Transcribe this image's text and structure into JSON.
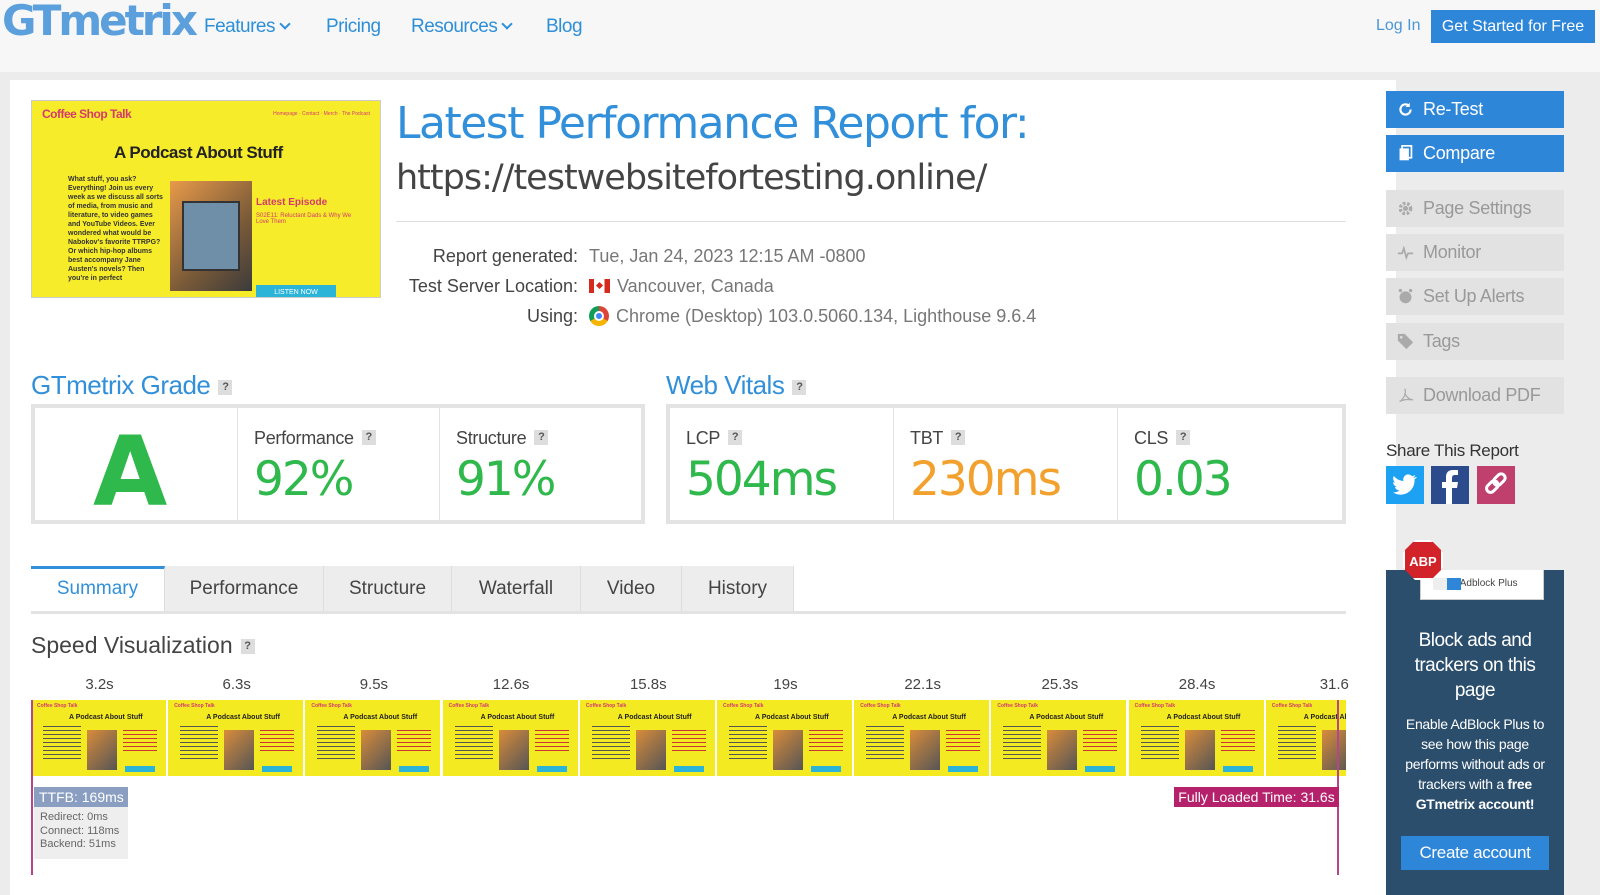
{
  "nav": {
    "logo": "GTmetrix",
    "items": [
      "Features",
      "Pricing",
      "Resources",
      "Blog"
    ],
    "login": "Log In",
    "get_started": "Get Started for Free"
  },
  "report": {
    "title": "Latest Performance Report for:",
    "url": "https://testwebsitefortesting.online/",
    "generated_label": "Report generated:",
    "generated_value": "Tue, Jan 24, 2023 12:15 AM -0800",
    "location_label": "Test Server Location:",
    "location_value": "Vancouver, Canada",
    "using_label": "Using:",
    "using_value": "Chrome (Desktop) 103.0.5060.134, Lighthouse 9.6.4"
  },
  "thumbnail": {
    "site_name": "Coffee Shop Talk",
    "nav": "Homepage · Contact · Merch · The Podcast",
    "headline": "A Podcast About Stuff",
    "intro": "What stuff, you ask? Everything! Join us every week as we discuss all sorts of media, from music and literature, to video games and YouTube Videos. Ever wondered what would be Nabokov's favorite TTRPG? Or which hip-hop albums best accompany Jane Austen's novels? Then you're in perfect",
    "latest": "Latest Episode",
    "episode": "S02E11: Reluctant Dads & Why We Love Them",
    "cta": "LISTEN NOW"
  },
  "grade": {
    "heading": "GTmetrix Grade",
    "letter": "A",
    "performance_label": "Performance",
    "performance_value": "92%",
    "structure_label": "Structure",
    "structure_value": "91%"
  },
  "vitals": {
    "heading": "Web Vitals",
    "lcp_label": "LCP",
    "lcp_value": "504ms",
    "tbt_label": "TBT",
    "tbt_value": "230ms",
    "cls_label": "CLS",
    "cls_value": "0.03"
  },
  "colors": {
    "brand_blue": "#3190d9",
    "good_green": "#2fb84b",
    "warn_orange": "#f2a12e",
    "frame_yellow": "#f4ea22",
    "marker_pink": "#b5226b"
  },
  "tabs": [
    "Summary",
    "Performance",
    "Structure",
    "Waterfall",
    "Video",
    "History"
  ],
  "speed": {
    "heading": "Speed Visualization",
    "frame_times": [
      "3.2s",
      "6.3s",
      "9.5s",
      "12.6s",
      "15.8s",
      "19s",
      "22.1s",
      "25.3s",
      "28.4s",
      "31.6"
    ],
    "frame_label": "A Podcast About Stuff",
    "ttfb": "TTFB: 169ms",
    "redirect": "Redirect: 0ms",
    "connect": "Connect: 118ms",
    "backend": "Backend: 51ms",
    "fully_loaded": "Fully Loaded Time: 31.6s"
  },
  "sidebar": {
    "retest": "Re-Test",
    "compare": "Compare",
    "page_settings": "Page Settings",
    "monitor": "Monitor",
    "alerts": "Set Up Alerts",
    "tags": "Tags",
    "download": "Download PDF",
    "share": "Share This Report"
  },
  "ad": {
    "badge": "ABP",
    "toggle_on": "ON",
    "toggle_label": "Adblock Plus",
    "headline": "Block ads and trackers on this page",
    "body_pre": "Enable AdBlock Plus to see how this page performs without ads or trackers with a ",
    "body_bold": "free GTmetrix account!",
    "button": "Create account"
  }
}
